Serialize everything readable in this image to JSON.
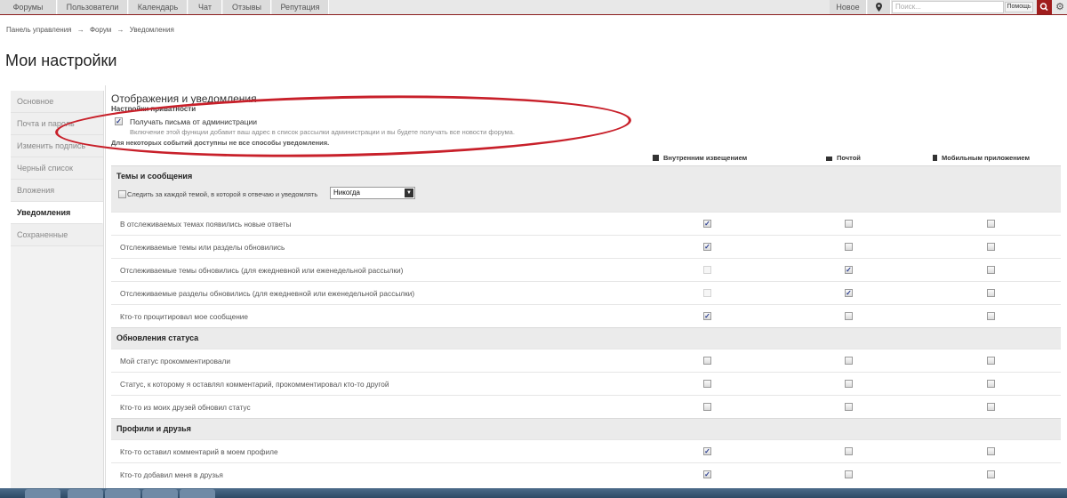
{
  "topnav": {
    "tabs": [
      "Форумы",
      "Пользователи",
      "Календарь",
      "Чат",
      "Отзывы",
      "Репутация"
    ],
    "new_label": "Новое",
    "search_placeholder": "Поиск...",
    "help_label": "Помощь"
  },
  "breadcrumb": {
    "items": [
      "Панель управления",
      "Форум",
      "Уведомления"
    ],
    "separator": "→"
  },
  "page_title": "Мои настройки",
  "sidebar": {
    "items": [
      {
        "label": "Основное",
        "active": false
      },
      {
        "label": "Почта и пароль",
        "active": false
      },
      {
        "label": "Изменить подпись",
        "active": false
      },
      {
        "label": "Черный список",
        "active": false
      },
      {
        "label": "Вложения",
        "active": false
      },
      {
        "label": "Уведомления",
        "active": true
      },
      {
        "label": "Сохраненные",
        "active": false
      }
    ]
  },
  "main": {
    "title": "Отображения и уведомления",
    "privacy_heading": "Настройки приватности",
    "admin_emails_label": "Получать письма от администрации",
    "admin_emails_checked": true,
    "admin_emails_desc": "Включение этой функции добавит ваш адрес в список рассылки администрации и вы будете получать все новости форума.",
    "note": "Для некоторых событий доступны не все способы уведомления.",
    "columns": [
      "Внутренним извещением",
      "Почтой",
      "Мобильным приложением"
    ],
    "follow_label": "Следить за каждой темой, в которой я отвечаю и уведомлять",
    "follow_checked": false,
    "follow_select": "Никогда",
    "groups": [
      {
        "title": "Темы и сообщения",
        "rows": [
          {
            "label": "В отслеживаемых темах появились новые ответы",
            "checks": [
              true,
              false,
              false
            ],
            "disabled": [
              false,
              false,
              false
            ]
          },
          {
            "label": "Отслеживаемые темы или разделы обновились",
            "checks": [
              true,
              false,
              false
            ],
            "disabled": [
              false,
              false,
              false
            ]
          },
          {
            "label": "Отслеживаемые темы обновились (для ежедневной или еженедельной рассылки)",
            "checks": [
              false,
              true,
              false
            ],
            "disabled": [
              true,
              false,
              false
            ]
          },
          {
            "label": "Отслеживаемые разделы обновились (для ежедневной или еженедельной рассылки)",
            "checks": [
              false,
              true,
              false
            ],
            "disabled": [
              true,
              false,
              false
            ]
          },
          {
            "label": "Кто-то процитировал мое сообщение",
            "checks": [
              true,
              false,
              false
            ],
            "disabled": [
              false,
              false,
              false
            ]
          }
        ]
      },
      {
        "title": "Обновления статуса",
        "rows": [
          {
            "label": "Мой статус прокомментировали",
            "checks": [
              false,
              false,
              false
            ],
            "disabled": [
              false,
              false,
              false
            ]
          },
          {
            "label": "Статус, к которому я оставлял комментарий, прокомментировал кто-то другой",
            "checks": [
              false,
              false,
              false
            ],
            "disabled": [
              false,
              false,
              false
            ]
          },
          {
            "label": "Кто-то из моих друзей обновил статус",
            "checks": [
              false,
              false,
              false
            ],
            "disabled": [
              false,
              false,
              false
            ]
          }
        ]
      },
      {
        "title": "Профили и друзья",
        "rows": [
          {
            "label": "Кто-то оставил комментарий в моем профиле",
            "checks": [
              true,
              false,
              false
            ],
            "disabled": [
              false,
              false,
              false
            ]
          },
          {
            "label": "Кто-то добавил меня в друзья",
            "checks": [
              true,
              false,
              false
            ],
            "disabled": [
              false,
              false,
              false
            ]
          }
        ]
      }
    ]
  },
  "colors": {
    "accent": "#a01d1d",
    "annotation_oval": "#c8202a"
  }
}
